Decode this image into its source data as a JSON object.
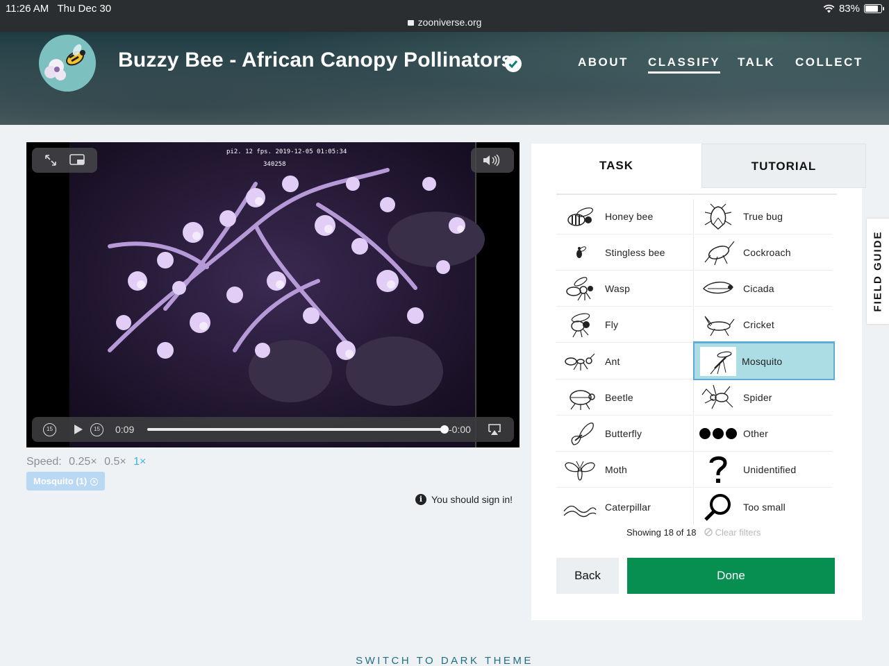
{
  "status_bar": {
    "time": "11:26 AM",
    "date": "Thu Dec 30",
    "url": "zooniverse.org",
    "battery": "83%",
    "battery_level": 0.83
  },
  "header": {
    "project_title": "Buzzy Bee - African Canopy Pollinators",
    "nav": [
      {
        "label": "ABOUT",
        "active": false
      },
      {
        "label": "CLASSIFY",
        "active": true
      },
      {
        "label": "TALK",
        "active": false
      },
      {
        "label": "COLLECT",
        "active": false
      }
    ]
  },
  "viewer": {
    "stamp_line1": "pi2. 12 fps. 2019-12-05 01:05:34",
    "stamp_line2": "340258",
    "elapsed": "0:09",
    "remaining": "-0:00",
    "progress": 1.0,
    "skip_back": "15",
    "skip_forward": "15"
  },
  "speed": {
    "label": "Speed:",
    "options": [
      "0.25×",
      "0.5×",
      "1×"
    ],
    "current": "1×"
  },
  "selected_tag": "Mosquito (1)",
  "sign_in_notice": "You should sign in!",
  "task_panel": {
    "tabs": [
      "TASK",
      "TUTORIAL"
    ],
    "left_column": [
      {
        "label": "Honey bee",
        "icon": "honey-bee-icon"
      },
      {
        "label": "Stingless bee",
        "icon": "stingless-bee-icon"
      },
      {
        "label": "Wasp",
        "icon": "wasp-icon"
      },
      {
        "label": "Fly",
        "icon": "fly-icon"
      },
      {
        "label": "Ant",
        "icon": "ant-icon"
      },
      {
        "label": "Beetle",
        "icon": "beetle-icon"
      },
      {
        "label": "Butterfly",
        "icon": "butterfly-icon"
      },
      {
        "label": "Moth",
        "icon": "moth-icon"
      },
      {
        "label": "Caterpillar",
        "icon": "caterpillar-icon"
      }
    ],
    "right_column": [
      {
        "label": "True bug",
        "icon": "true-bug-icon"
      },
      {
        "label": "Cockroach",
        "icon": "cockroach-icon"
      },
      {
        "label": "Cicada",
        "icon": "cicada-icon"
      },
      {
        "label": "Cricket",
        "icon": "cricket-icon"
      },
      {
        "label": "Mosquito",
        "icon": "mosquito-icon",
        "selected": true
      },
      {
        "label": "Spider",
        "icon": "spider-icon"
      },
      {
        "label": "Other",
        "icon": "other-dots-icon"
      },
      {
        "label": "Unidentified",
        "icon": "question-mark-icon"
      },
      {
        "label": "Too small",
        "icon": "magnifier-icon"
      }
    ],
    "showing": "Showing 18 of 18",
    "clear_filters": "Clear filters",
    "back_label": "Back",
    "done_label": "Done"
  },
  "field_guide_label": "FIELD GUIDE",
  "theme_toggle": "SWITCH TO DARK THEME",
  "colors": {
    "done_green": "#078f52",
    "selected_bg": "#addde4",
    "accent_blue": "#3ab3e0",
    "theme_link": "#1f6f84"
  }
}
